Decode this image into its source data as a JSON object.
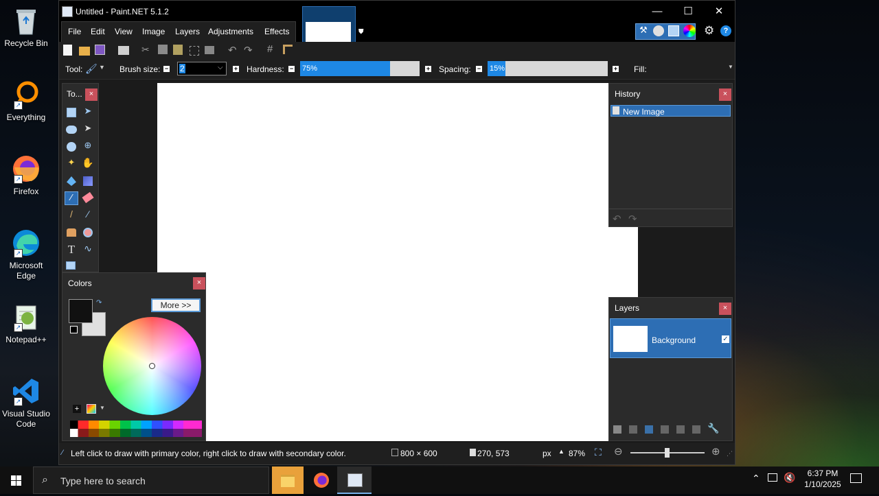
{
  "desktop": {
    "icons": [
      {
        "label": "Recycle Bin"
      },
      {
        "label": "Everything"
      },
      {
        "label": "Firefox"
      },
      {
        "label": "Microsoft Edge"
      },
      {
        "label": "Notepad++"
      },
      {
        "label": "Visual Studio Code"
      }
    ]
  },
  "window": {
    "title": "Untitled - Paint.NET 5.1.2",
    "menu": [
      "File",
      "Edit",
      "View",
      "Image",
      "Layers",
      "Adjustments",
      "Effects"
    ]
  },
  "options": {
    "tool_label": "Tool:",
    "brush_size_label": "Brush size:",
    "brush_size_value": "2",
    "hardness_label": "Hardness:",
    "hardness_value": "75%",
    "hardness_fraction": 0.75,
    "spacing_label": "Spacing:",
    "spacing_value": "15%",
    "spacing_fraction": 0.15,
    "fill_label": "Fill:"
  },
  "tools_panel": {
    "title": "To..."
  },
  "history_panel": {
    "title": "History",
    "items": [
      "New Image"
    ]
  },
  "layers_panel": {
    "title": "Layers",
    "layers": [
      {
        "name": "Background",
        "visible": true
      }
    ]
  },
  "colors_panel": {
    "title": "Colors",
    "more_label": "More >>",
    "primary_color": "#111111",
    "secondary_color": "#e0e0e0"
  },
  "status": {
    "hint": "Left click to draw with primary color, right click to draw with secondary color.",
    "image_size": "800 × 600",
    "cursor_pos": "270, 573",
    "unit": "px",
    "zoom": "87%"
  },
  "taskbar": {
    "search_placeholder": "Type here to search",
    "time": "6:37 PM",
    "date": "1/10/2025"
  },
  "colors": {
    "accent": "#1e88e5",
    "selection": "#2d6eb4",
    "close_red": "#c9515c"
  }
}
